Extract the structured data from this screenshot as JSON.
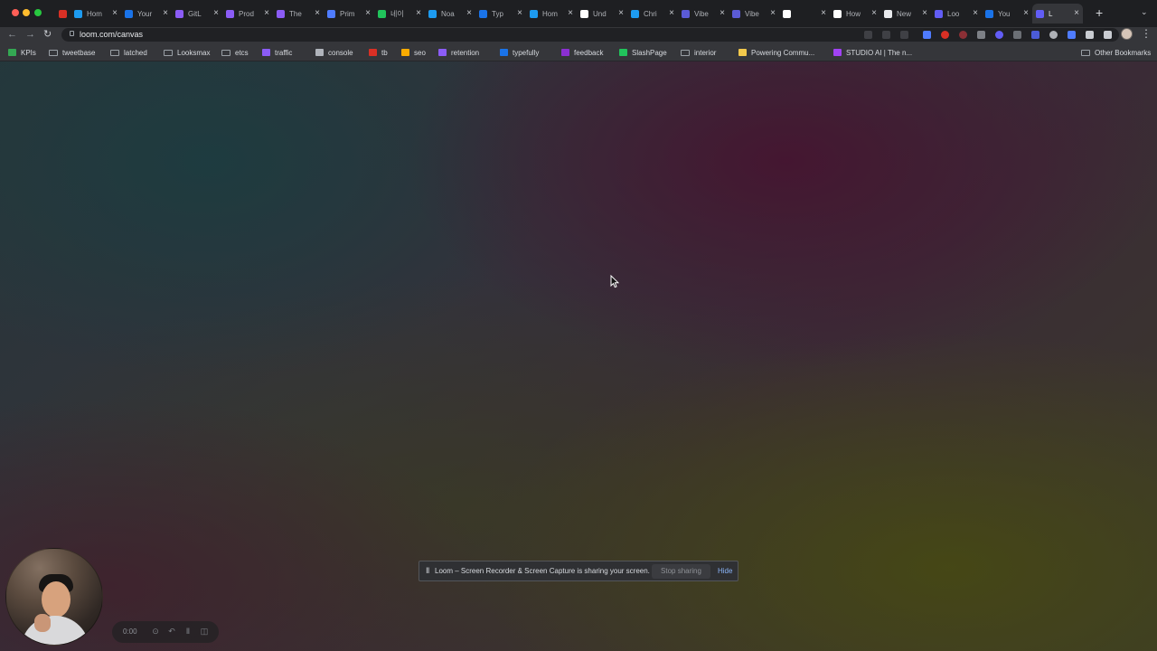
{
  "tabs": [
    {
      "title": "",
      "favicon_color": "#d93025",
      "pinned": true
    },
    {
      "title": "Hom",
      "favicon_color": "#1d9bf0"
    },
    {
      "title": "Your",
      "favicon_color": "#1a73e8"
    },
    {
      "title": "GitL",
      "favicon_color": "#8b5cf6"
    },
    {
      "title": "Prod",
      "favicon_color": "#8b5cf6"
    },
    {
      "title": "The",
      "favicon_color": "#8b5cf6"
    },
    {
      "title": "Prim",
      "favicon_color": "#4f7cff"
    },
    {
      "title": "네이",
      "favicon_color": "#21c35b"
    },
    {
      "title": "Noa",
      "favicon_color": "#1d9bf0"
    },
    {
      "title": "Typ",
      "favicon_color": "#1a73e8"
    },
    {
      "title": "Hom",
      "favicon_color": "#1d9bf0"
    },
    {
      "title": "Und",
      "favicon_color": "#ffffff"
    },
    {
      "title": "Chri",
      "favicon_color": "#1d9bf0"
    },
    {
      "title": "Vibe",
      "favicon_color": "#5b5bd6"
    },
    {
      "title": "Vibe",
      "favicon_color": "#5b5bd6"
    },
    {
      "title": "",
      "favicon_color": "#ffffff"
    },
    {
      "title": "How",
      "favicon_color": "#ffffff"
    },
    {
      "title": "New",
      "favicon_color": "#e8eaed"
    },
    {
      "title": "Loo",
      "favicon_color": "#625df5"
    },
    {
      "title": "You",
      "favicon_color": "#1a73e8"
    },
    {
      "title": "L",
      "favicon_color": "#625df5",
      "active": true
    }
  ],
  "url": "loom.com/canvas",
  "bookmarks": [
    {
      "label": "KPIs",
      "icon_color": "#34a853"
    },
    {
      "label": "tweetbase",
      "icon": "folder"
    },
    {
      "label": "latched",
      "icon": "folder"
    },
    {
      "label": "Looksmax",
      "icon": "folder"
    },
    {
      "label": "etcs",
      "icon": "folder"
    },
    {
      "label": "traffic",
      "icon_color": "#8b5cf6"
    },
    {
      "label": "console",
      "icon_color": "#b0b4bb"
    },
    {
      "label": "tb",
      "icon_color": "#d93025"
    },
    {
      "label": "seo",
      "icon_color": "#f9ab00"
    },
    {
      "label": "retention",
      "icon_color": "#8b5cf6"
    },
    {
      "label": "typefully",
      "icon_color": "#1a73e8"
    },
    {
      "label": "feedback",
      "icon_color": "#8b2fd1"
    },
    {
      "label": "SlashPage",
      "icon_color": "#21c35b"
    },
    {
      "label": "interior",
      "icon": "folder"
    },
    {
      "label": "Powering Commu...",
      "icon_color": "#f2c94c"
    },
    {
      "label": "STUDIO AI | The n...",
      "icon_color": "#a142f4"
    }
  ],
  "other_bookmarks": "Other Bookmarks",
  "recorder": {
    "time": "0:00"
  },
  "sharing_bar": {
    "message": "Loom – Screen Recorder & Screen Capture is sharing your screen.",
    "stop_label": "Stop sharing",
    "hide_label": "Hide"
  }
}
